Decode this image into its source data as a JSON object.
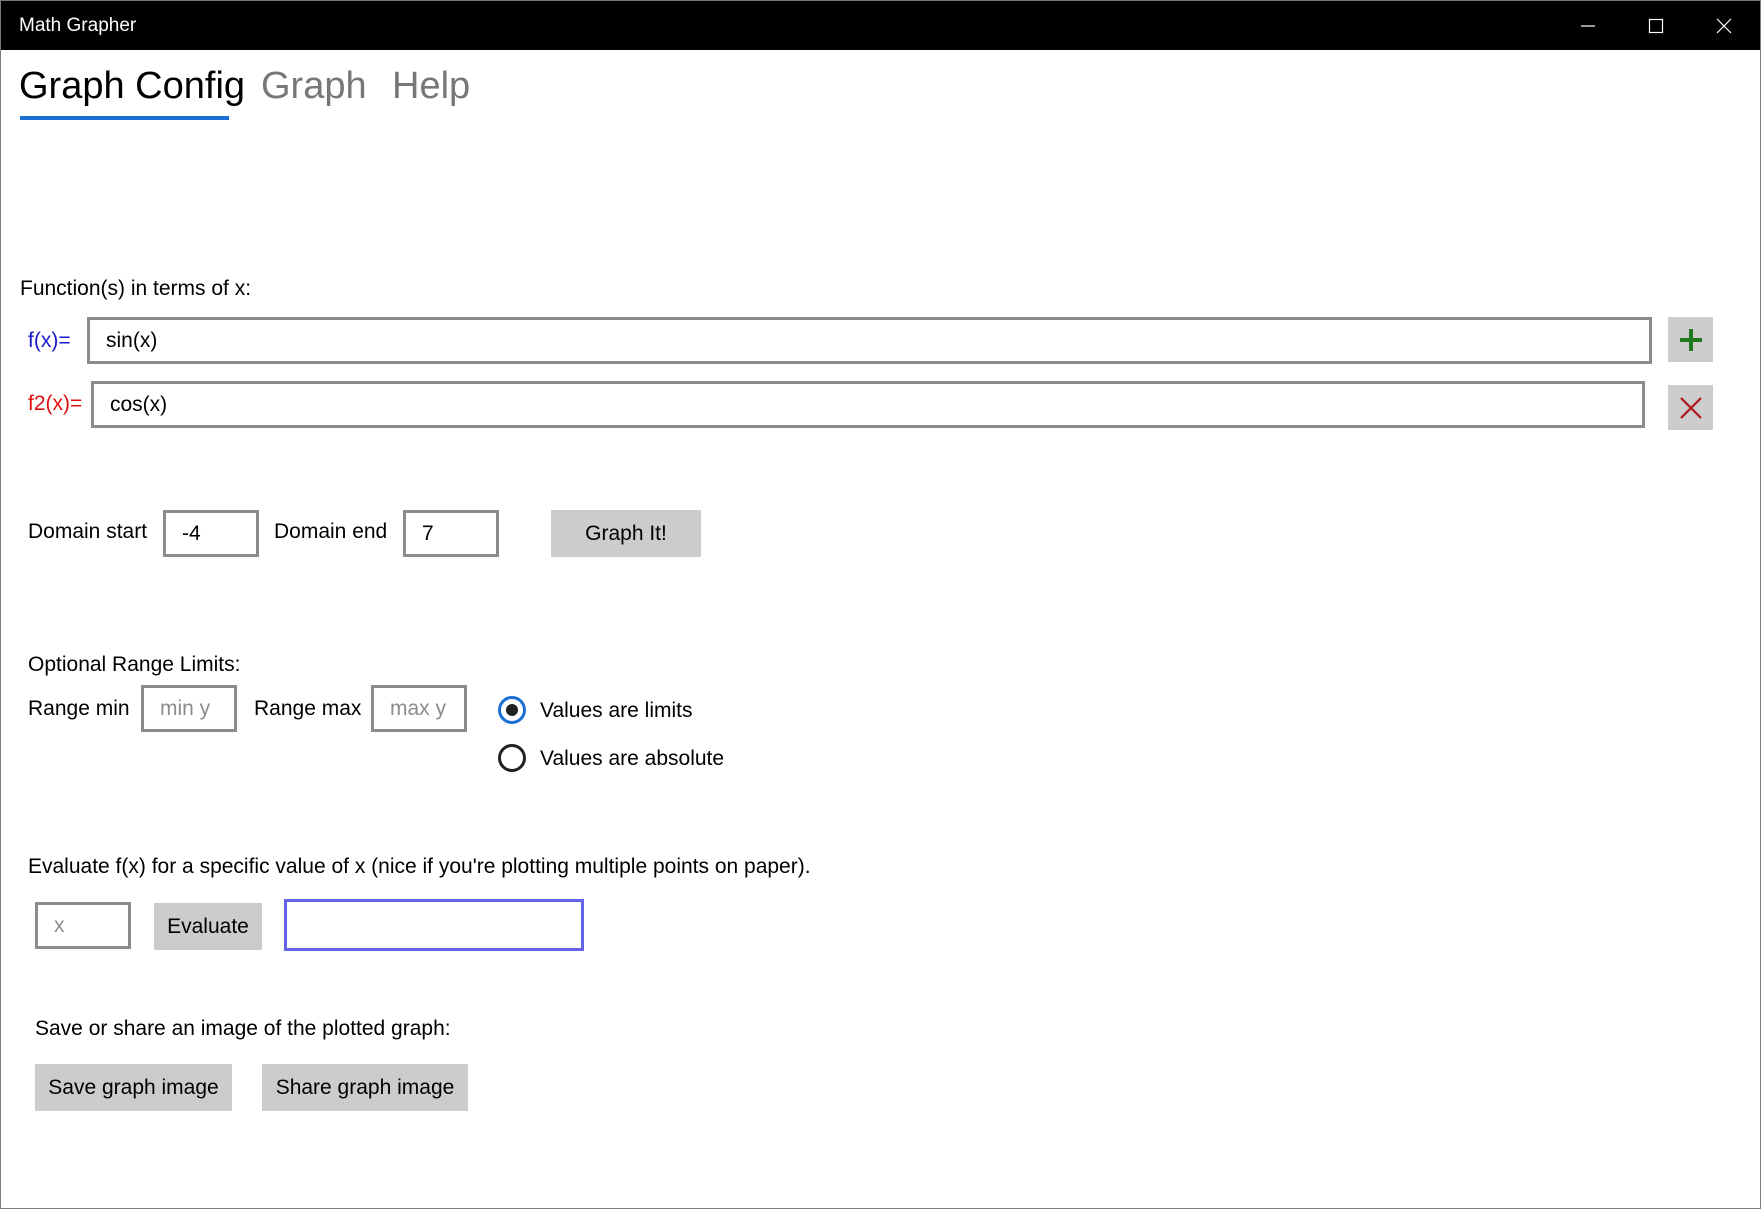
{
  "window": {
    "title": "Math Grapher",
    "minimize_glyph": "─",
    "maximize_glyph": "☐",
    "close_glyph": "✕"
  },
  "tabs": [
    {
      "label": "Graph Config",
      "active": true
    },
    {
      "label": "Graph",
      "active": false
    },
    {
      "label": "Help",
      "active": false
    }
  ],
  "functions": {
    "heading": "Function(s) in terms of x:",
    "items": [
      {
        "label": "f(x)=",
        "value": "sin(x)",
        "color": "#1a1acc",
        "action": "add",
        "action_icon": "plus-icon"
      },
      {
        "label": "f2(x)=",
        "value": "cos(x)",
        "color": "#e01010",
        "action": "remove",
        "action_icon": "close-icon"
      }
    ]
  },
  "domain": {
    "start_label": "Domain start",
    "start_value": "-4",
    "end_label": "Domain end",
    "end_value": "7",
    "graph_button": "Graph It!"
  },
  "range": {
    "heading": "Optional Range Limits:",
    "min_label": "Range min",
    "min_placeholder": "min y",
    "max_label": "Range max",
    "max_placeholder": "max y",
    "options": [
      {
        "label": "Values are limits",
        "checked": true
      },
      {
        "label": "Values are absolute",
        "checked": false
      }
    ]
  },
  "evaluate": {
    "description": "Evaluate f(x) for a specific value of x (nice if you're plotting multiple points on paper).",
    "x_placeholder": "x",
    "button": "Evaluate",
    "result_value": ""
  },
  "share": {
    "description": "Save or share an image of the plotted graph:",
    "save_button": "Save graph image",
    "share_button": "Share graph image"
  },
  "colors": {
    "accent": "#1a6fd4",
    "add_icon": "#1f7a1f",
    "remove_icon": "#b01515",
    "button_bg": "#cccccc",
    "focus_border": "#6464e6"
  }
}
